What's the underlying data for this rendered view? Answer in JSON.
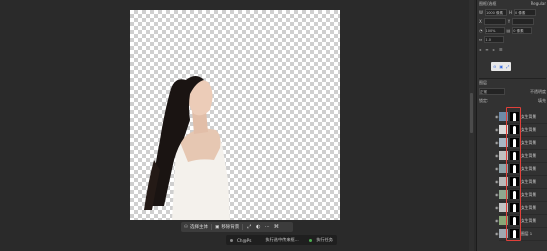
{
  "context_bar": {
    "select_subject_label": "选择主体",
    "remove_bg_label": "移除背景"
  },
  "status": {
    "left_label": "Ch@Ps",
    "message": "执行选中传来框...",
    "right_label": "执行任务"
  },
  "right_panel": {
    "properties_title": "图框/选框",
    "top_right_label": "Regular",
    "w_value": "1000 像素",
    "h_value": "0 像素",
    "opacity_value": "100%",
    "fill_value": "0 像素",
    "zoom_value": "1.0",
    "layers_title": "图层",
    "blend_mode_label": "正常",
    "opacity_label": "不透明度",
    "lock_label": "锁定:",
    "fill_label": "填充",
    "layers": [
      {
        "name": "女生背景"
      },
      {
        "name": "女生背景"
      },
      {
        "name": "女生背景"
      },
      {
        "name": "女生背景"
      },
      {
        "name": "女生背景"
      },
      {
        "name": "女生背景"
      },
      {
        "name": "女生背景"
      },
      {
        "name": "女生背景"
      },
      {
        "name": "女生背景"
      },
      {
        "name": "图层 1"
      }
    ]
  },
  "colors": {
    "workspace_bg": "#2a2a2a",
    "panel_bg": "#323232",
    "highlight_border": "#e0403a",
    "status_green": "#4caf50"
  }
}
